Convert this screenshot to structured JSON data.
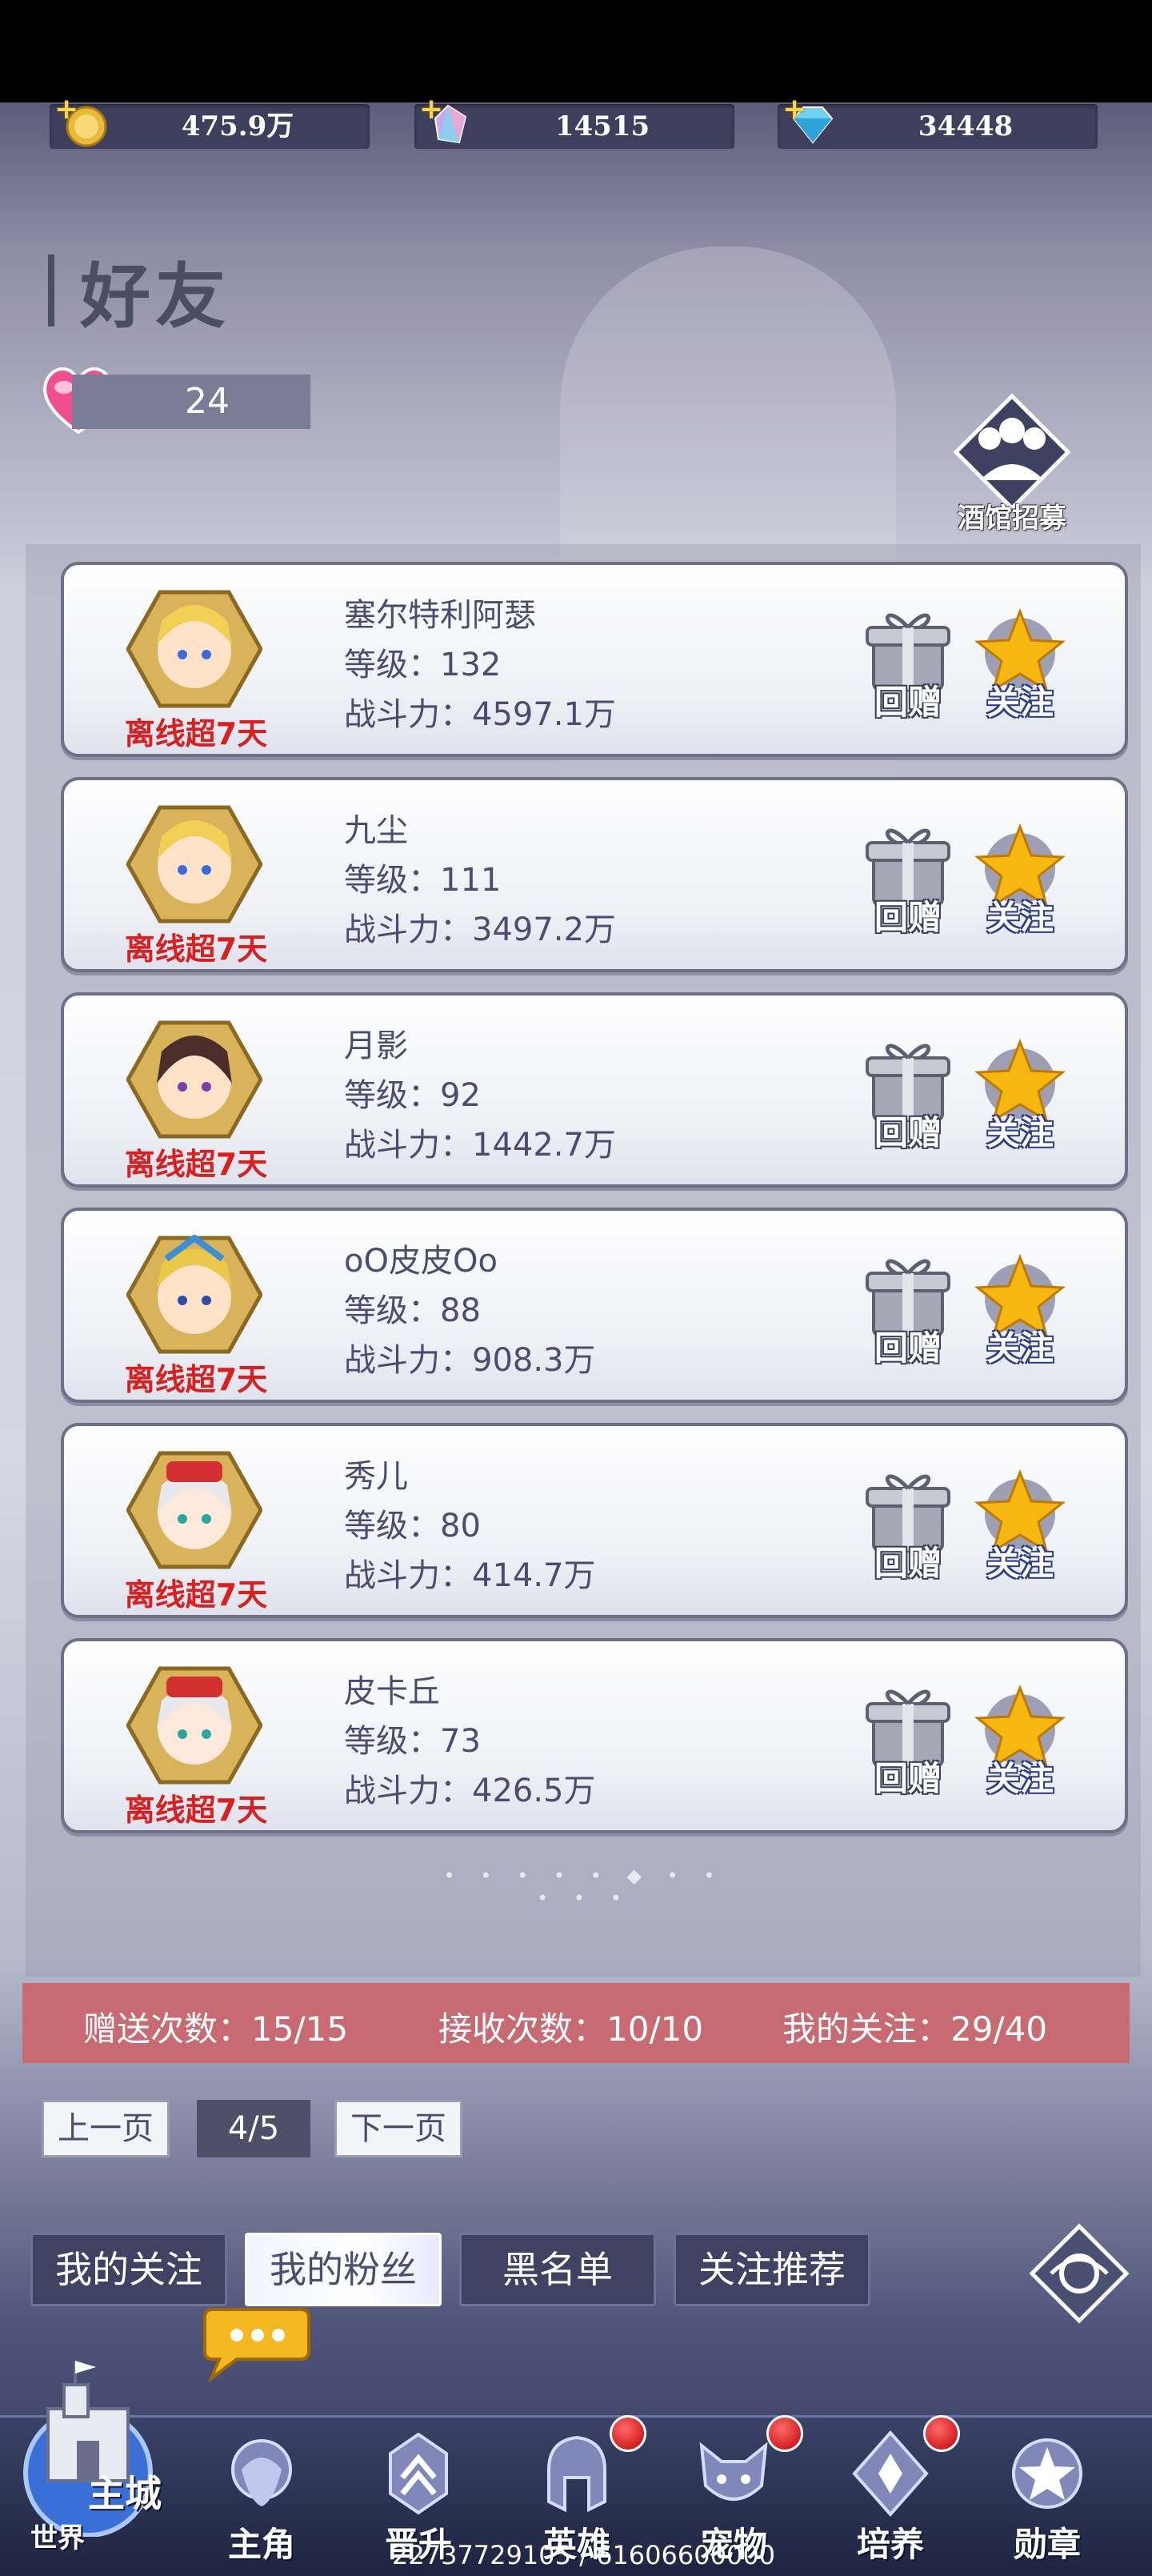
{
  "resources": [
    {
      "icon": "gold-coin-icon",
      "value": "475.9万"
    },
    {
      "icon": "rainbow-gem-icon",
      "value": "14515"
    },
    {
      "icon": "diamond-icon",
      "value": "34448"
    }
  ],
  "header": {
    "title": "好友",
    "hearts": "24",
    "recruit_label": "酒馆招募"
  },
  "friends": [
    {
      "name": "塞尔特利阿瑟",
      "level": "等级：132",
      "power": "战斗力：4597.1万",
      "status": "离线超7天",
      "gift": "回赠",
      "follow": "关注"
    },
    {
      "name": "九尘",
      "level": "等级：111",
      "power": "战斗力：3497.2万",
      "status": "离线超7天",
      "gift": "回赠",
      "follow": "关注"
    },
    {
      "name": "月影",
      "level": "等级：92",
      "power": "战斗力：1442.7万",
      "status": "离线超7天",
      "gift": "回赠",
      "follow": "关注"
    },
    {
      "name": "oO皮皮Oo",
      "level": "等级：88",
      "power": "战斗力：908.3万",
      "status": "离线超7天",
      "gift": "回赠",
      "follow": "关注"
    },
    {
      "name": "秀儿",
      "level": "等级：80",
      "power": "战斗力：414.7万",
      "status": "离线超7天",
      "gift": "回赠",
      "follow": "关注"
    },
    {
      "name": "皮卡丘",
      "level": "等级：73",
      "power": "战斗力：426.5万",
      "status": "离线超7天",
      "gift": "回赠",
      "follow": "关注"
    }
  ],
  "stats": {
    "sent": "赠送次数：15/15",
    "received": "接收次数：10/10",
    "following": "我的关注：29/40"
  },
  "pagination": {
    "prev": "上一页",
    "page": "4/5",
    "next": "下一页"
  },
  "tabs": [
    "我的关注",
    "我的粉丝",
    "黑名单",
    "关注推荐"
  ],
  "active_tab": 1,
  "nav": {
    "home_label": "主城",
    "world_label": "世界",
    "items": [
      {
        "label": "主角",
        "badge": false
      },
      {
        "label": "晋升",
        "badge": false
      },
      {
        "label": "英雄",
        "badge": true
      },
      {
        "label": "宠物",
        "badge": true
      },
      {
        "label": "培养",
        "badge": true
      },
      {
        "label": "勋章",
        "badge": false
      }
    ]
  },
  "footer_text": "22737729105 / 61606600000",
  "colors": {
    "offline": "#d91f1f",
    "stats_bar": "#c86a72",
    "text": "#4a4d6e"
  }
}
